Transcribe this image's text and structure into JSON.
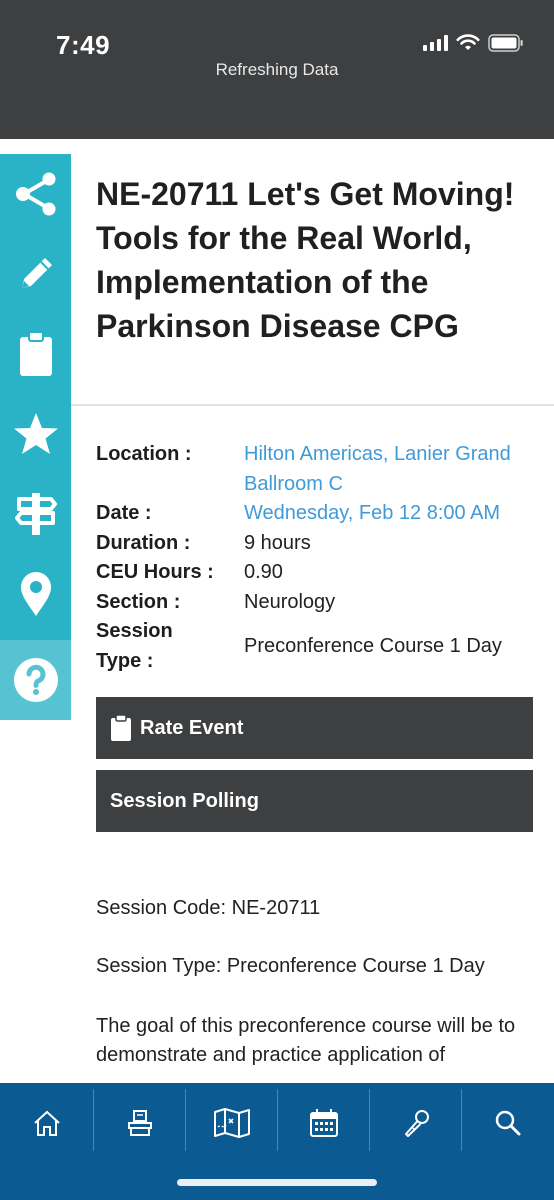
{
  "status_bar": {
    "time": "7:49",
    "subtitle": "Refreshing Data"
  },
  "rail": {
    "items": [
      {
        "icon": "share-icon"
      },
      {
        "icon": "pencil-icon"
      },
      {
        "icon": "clipboard-icon"
      },
      {
        "icon": "star-icon"
      },
      {
        "icon": "signpost-icon"
      },
      {
        "icon": "map-pin-icon"
      },
      {
        "icon": "help-icon"
      }
    ]
  },
  "session": {
    "title": "NE-20711 Let's Get Moving! Tools for the Real World, Implementation of the Parkinson Disease CPG",
    "details": {
      "location_label": "Location :",
      "location_value": "Hilton Americas, Lanier Grand Ballroom C",
      "date_label": "Date :",
      "date_value": "Wednesday, Feb 12 8:00 AM",
      "duration_label": "Duration :",
      "duration_value": "9 hours",
      "ceu_label": "CEU Hours :",
      "ceu_value": "0.90",
      "section_label": "Section :",
      "section_value": "Neurology",
      "session_type_label_1": "Session",
      "session_type_label_2": "Type :",
      "session_type_value": "Preconference Course 1 Day"
    },
    "buttons": {
      "rate_event": "Rate Event",
      "session_polling": "Session Polling"
    },
    "body": {
      "session_code": "Session Code: NE-20711",
      "session_type": "Session Type: Preconference Course 1 Day",
      "description": "The goal of this preconference course will be to demonstrate and practice application of"
    }
  },
  "bottom_nav": {
    "items": [
      {
        "icon": "home-icon"
      },
      {
        "icon": "booth-icon"
      },
      {
        "icon": "map-icon"
      },
      {
        "icon": "calendar-icon"
      },
      {
        "icon": "microphone-icon"
      },
      {
        "icon": "search-icon"
      }
    ]
  },
  "colors": {
    "header": "#3d3f41",
    "rail": "#2ab3c6",
    "link": "#3f9ad8",
    "bottom_nav": "#0b5a92"
  }
}
